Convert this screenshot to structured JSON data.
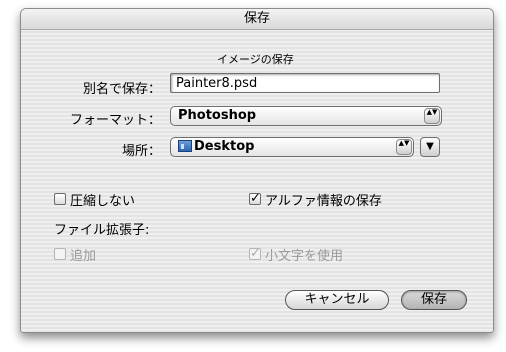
{
  "window": {
    "title": "保存"
  },
  "section_title": "イメージの保存",
  "save_as": {
    "label": "別名で保存：",
    "value": "Painter8.psd"
  },
  "format": {
    "label": "フォーマット：",
    "selected": "Photoshop"
  },
  "location": {
    "label": "場所：",
    "selected": "Desktop",
    "icon": "desktop-folder-icon"
  },
  "options": {
    "compress": {
      "label": "圧縮しない",
      "checked": false
    },
    "alpha": {
      "label": "アルファ情報の保存",
      "checked": true
    }
  },
  "extension": {
    "label": "ファイル拡張子:",
    "append": {
      "label": "追加",
      "checked": false,
      "enabled": false
    },
    "lowercase": {
      "label": "小文字を使用",
      "checked": true,
      "enabled": false
    }
  },
  "buttons": {
    "cancel": "キャンセル",
    "save": "保存"
  },
  "glyphs": {
    "check": "✓",
    "updown": "▲▼",
    "down": "▼"
  }
}
